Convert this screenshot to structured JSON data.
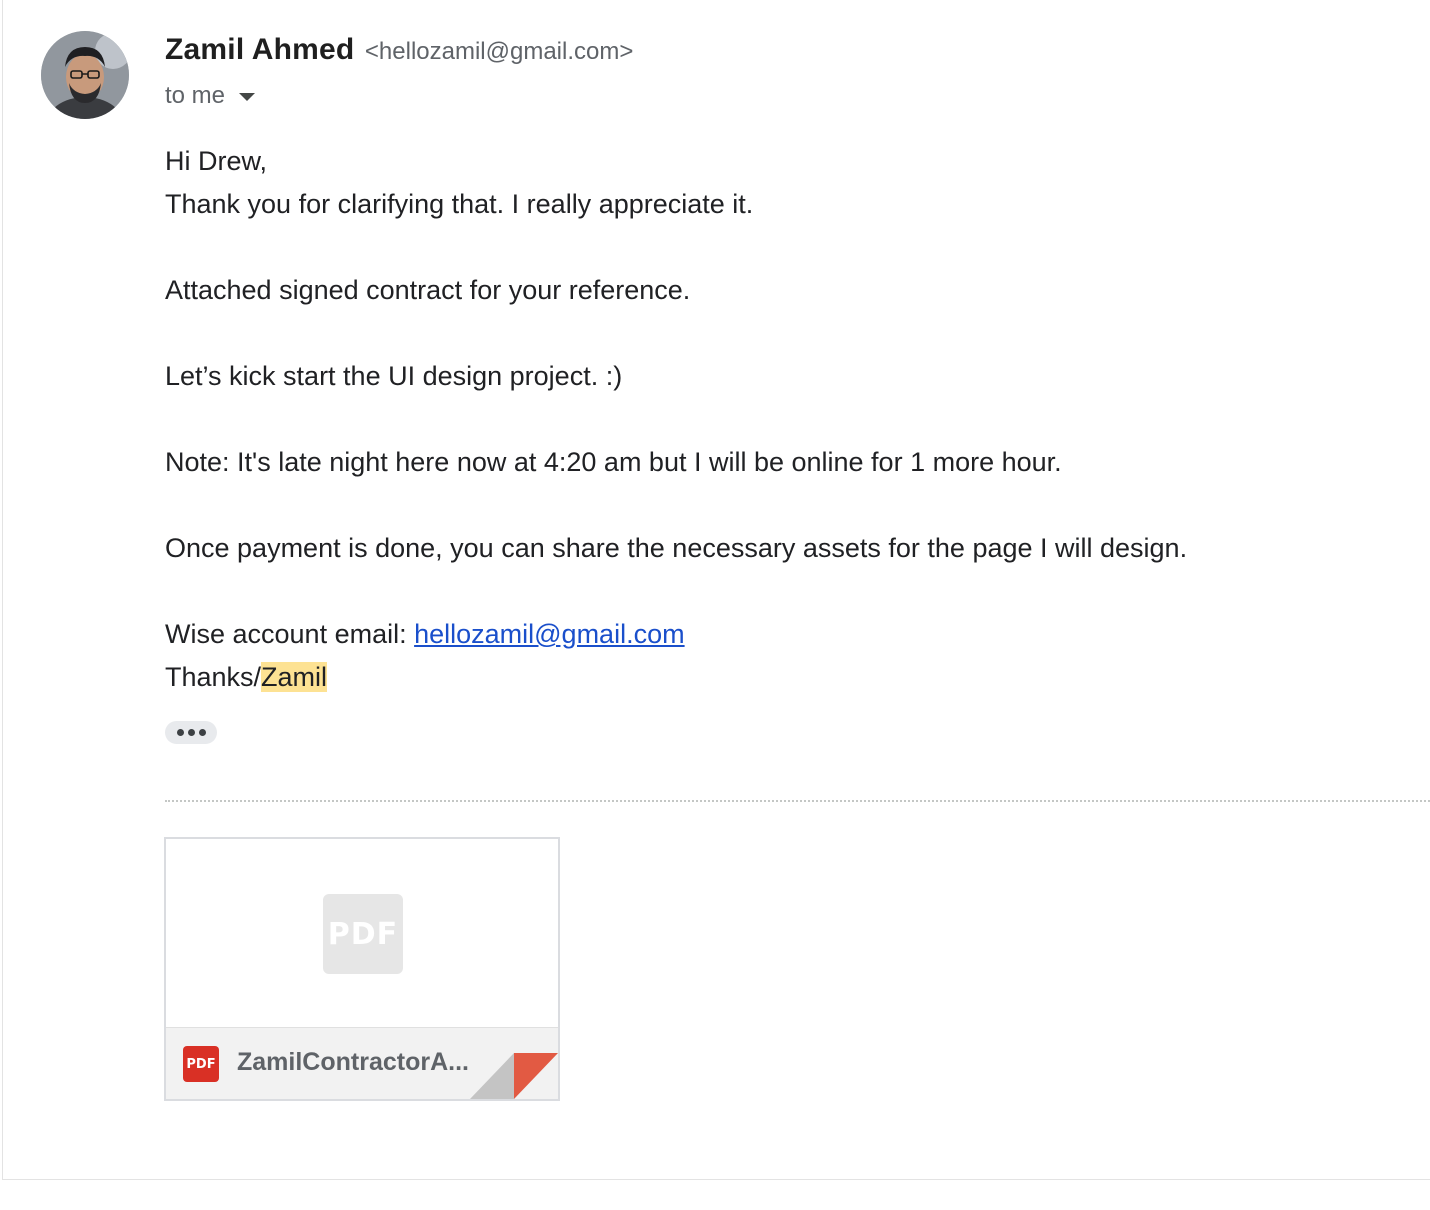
{
  "sender": {
    "name": "Zamil Ahmed",
    "email": "<hellozamil@gmail.com>",
    "recipient_label": "to me"
  },
  "body": {
    "greeting": "Hi Drew,",
    "line1": "Thank you for clarifying that. I really appreciate it.",
    "line2": "Attached signed contract for your reference.",
    "line3": "Let’s kick start the UI design project.  :)",
    "line4": "Note: It's late night here now at 4:20 am but I will be online for 1 more hour.",
    "line5": "Once payment is done, you can share the necessary assets for the page I will design.",
    "wise_label": "Wise account email: ",
    "wise_link": "hellozamil@gmail.com",
    "thanks_prefix": "Thanks/",
    "signature": "Zamil"
  },
  "attachment": {
    "file_name": "ZamilContractorA...",
    "preview_icon_label": "PDF",
    "type_badge": "PDF"
  },
  "colors": {
    "link": "#1a4fcb",
    "highlight": "#fde293",
    "pdf_red": "#d93025",
    "corner_fold": "#e25a43"
  }
}
